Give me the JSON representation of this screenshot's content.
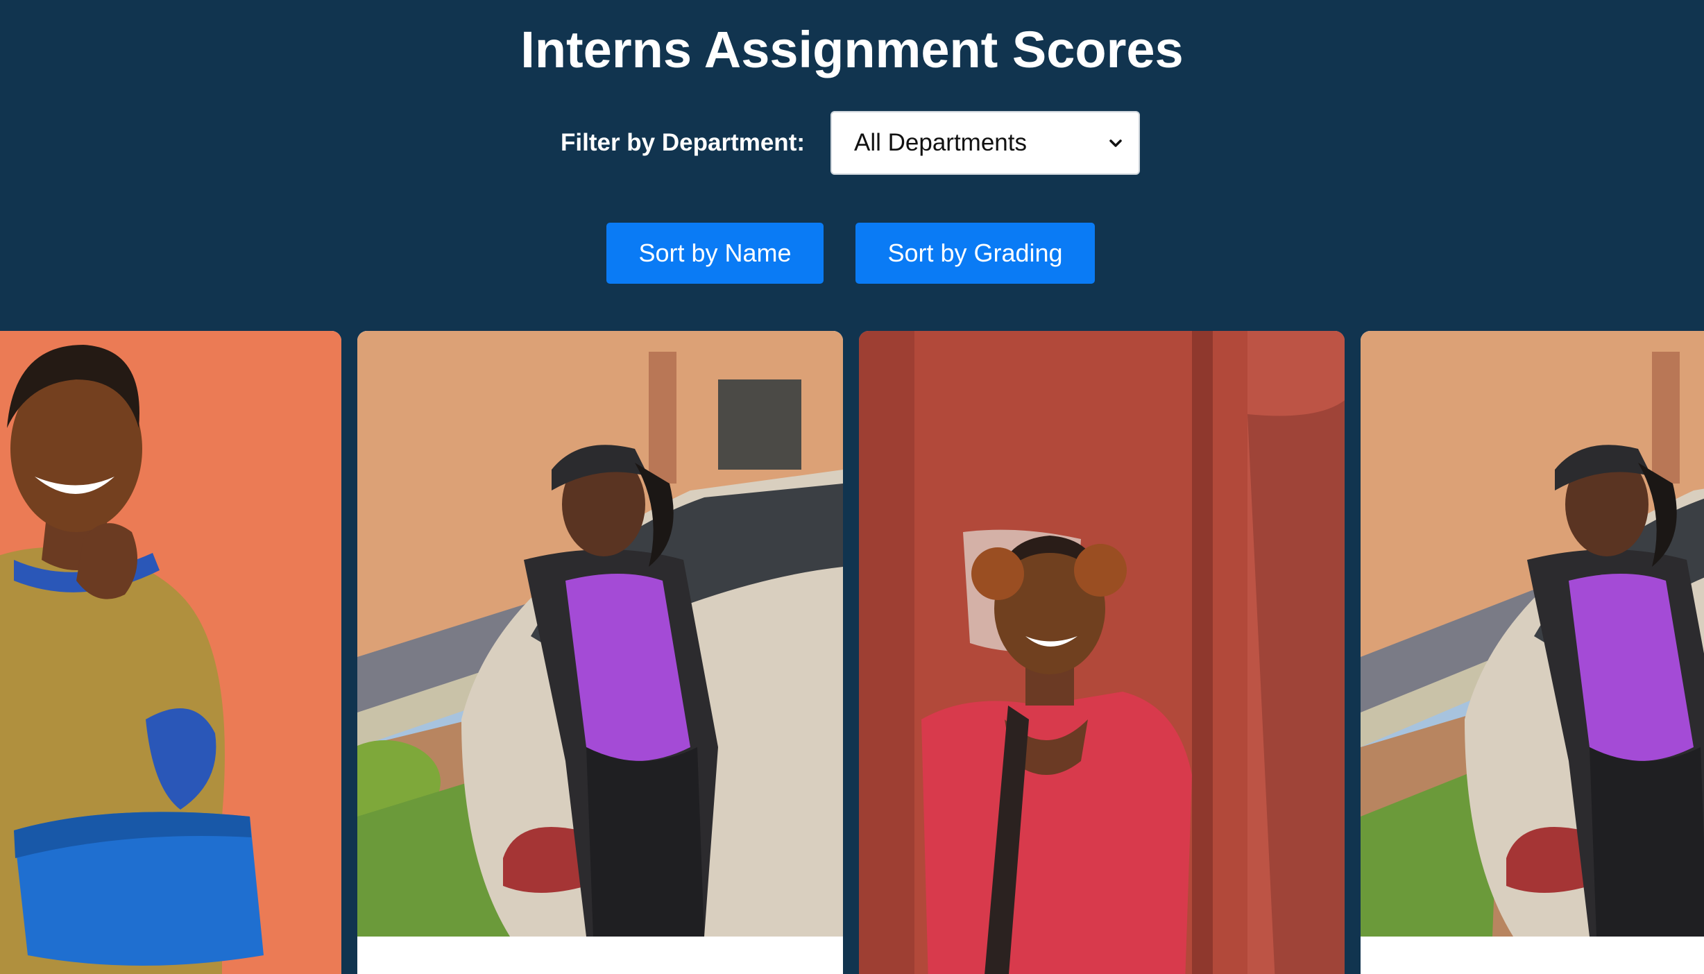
{
  "header": {
    "title": "Interns Assignment Scores"
  },
  "filter": {
    "label": "Filter by Department:",
    "selected": "All Departments"
  },
  "sort_buttons": {
    "by_name": "Sort by Name",
    "by_grading": "Sort by Grading"
  },
  "colors": {
    "background": "#11344f",
    "button": "#0a7bf5",
    "card": "#ffffff"
  },
  "cards": [
    {
      "photo": "intern-photo-1"
    },
    {
      "photo": "intern-photo-2"
    },
    {
      "photo": "intern-photo-3"
    },
    {
      "photo": "intern-photo-4"
    }
  ]
}
